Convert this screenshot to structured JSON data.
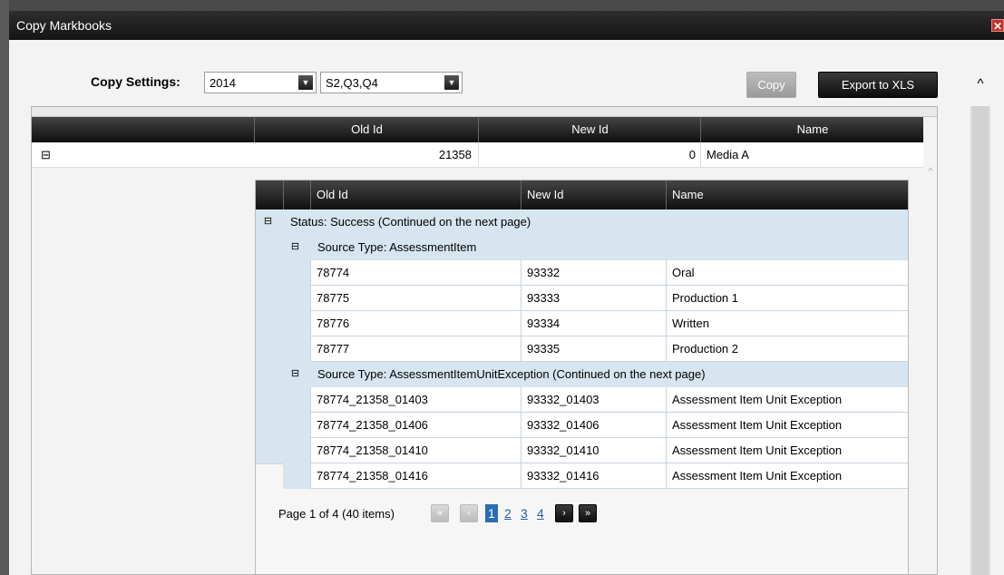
{
  "window": {
    "title": "Copy Markbooks",
    "close_symbol": "✕"
  },
  "settings": {
    "label": "Copy Settings:",
    "year": "2014",
    "terms": "S2,Q3,Q4"
  },
  "buttons": {
    "copy": "Copy",
    "export": "Export to XLS"
  },
  "outer_grid": {
    "columns": [
      "Old Id",
      "New Id",
      "Name"
    ],
    "row": {
      "old_id": "21358",
      "new_id": "0",
      "name": "Media A"
    }
  },
  "inner_grid": {
    "columns": [
      "Old Id",
      "New Id",
      "Name"
    ],
    "status_group": "Status: Success (Continued on the next page)",
    "groups": [
      {
        "label": "Source Type: AssessmentItem",
        "rows": [
          {
            "old_id": "78774",
            "new_id": "93332",
            "name": "Oral"
          },
          {
            "old_id": "78775",
            "new_id": "93333",
            "name": "Production 1"
          },
          {
            "old_id": "78776",
            "new_id": "93334",
            "name": "Written"
          },
          {
            "old_id": "78777",
            "new_id": "93335",
            "name": "Production 2"
          }
        ]
      },
      {
        "label": "Source Type: AssessmentItemUnitException (Continued on the next page)",
        "rows": [
          {
            "old_id": "78774_21358_01403",
            "new_id": "93332_01403",
            "name": "Assessment Item Unit Exception"
          },
          {
            "old_id": "78774_21358_01406",
            "new_id": "93332_01406",
            "name": "Assessment Item Unit Exception"
          },
          {
            "old_id": "78774_21358_01410",
            "new_id": "93332_01410",
            "name": "Assessment Item Unit Exception"
          },
          {
            "old_id": "78774_21358_01416",
            "new_id": "93332_01416",
            "name": "Assessment Item Unit Exception"
          }
        ]
      }
    ]
  },
  "pager": {
    "summary": "Page 1 of 4 (40 items)",
    "first": "«",
    "prev": "‹",
    "next": "›",
    "last": "»",
    "pages": [
      "1",
      "2",
      "3",
      "4"
    ]
  },
  "icons": {
    "collapse": "⊟",
    "dropdown": "▼",
    "scroll_up": "^"
  },
  "colors": {
    "header_dark": "#1a1a1a",
    "group_bg": "#d6e5ef",
    "link": "#1f5fa8",
    "close": "#c0302a"
  }
}
